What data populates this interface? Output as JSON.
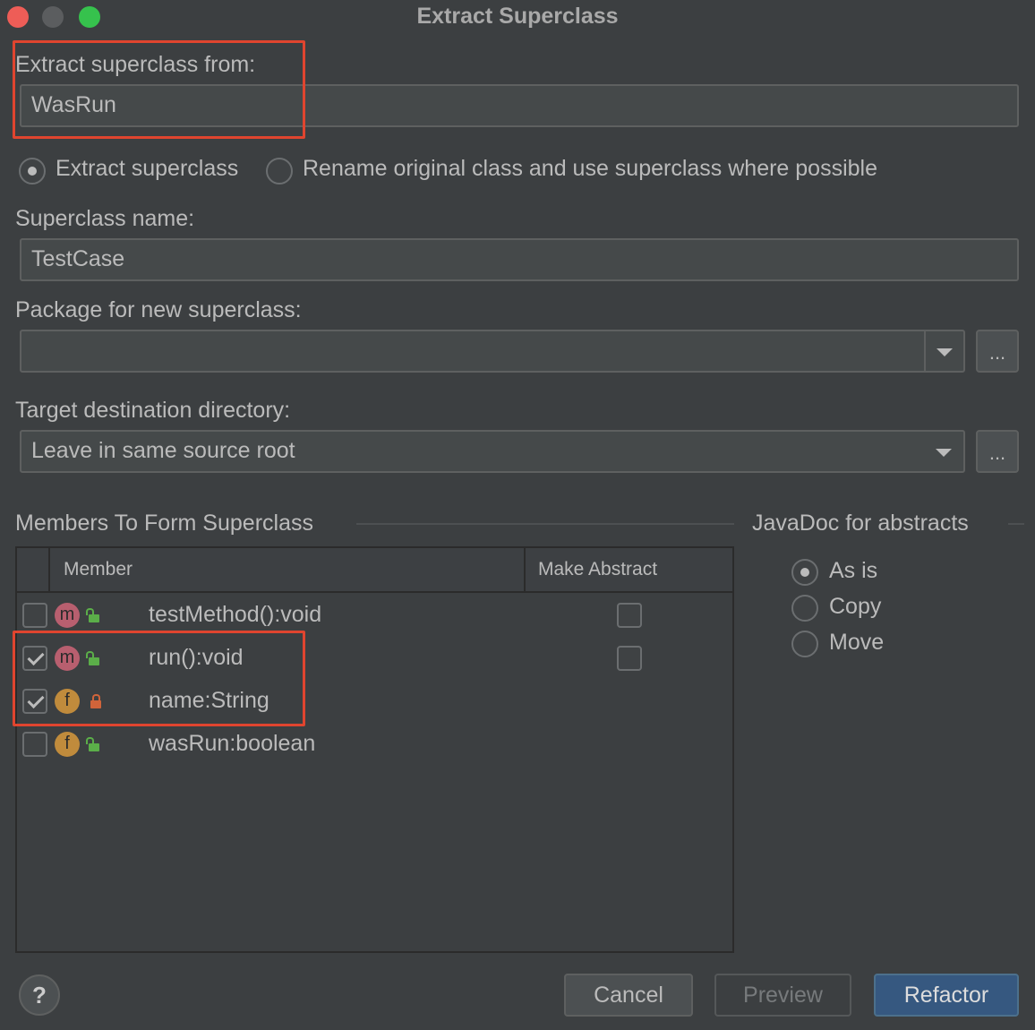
{
  "window": {
    "title": "Extract Superclass"
  },
  "extract_from": {
    "label": "Extract superclass from:",
    "value": "WasRun"
  },
  "mode": {
    "options": [
      {
        "label": "Extract superclass",
        "selected": true
      },
      {
        "label": "Rename original class and use superclass where possible",
        "selected": false
      }
    ]
  },
  "superclass_name": {
    "label": "Superclass name:",
    "value": "TestCase"
  },
  "package": {
    "label": "Package for new superclass:",
    "value": "",
    "browse_label": "..."
  },
  "target_dir": {
    "label": "Target destination directory:",
    "value": "Leave in same source root",
    "browse_label": "..."
  },
  "members": {
    "title": "Members To Form Superclass",
    "columns": [
      "Member",
      "Make Abstract"
    ],
    "rows": [
      {
        "checked": false,
        "kind": "m",
        "access": "public",
        "name": "testMethod():void",
        "make_abstract": false,
        "has_abstract_box": true
      },
      {
        "checked": true,
        "kind": "m",
        "access": "public",
        "name": "run():void",
        "make_abstract": false,
        "has_abstract_box": true
      },
      {
        "checked": true,
        "kind": "f",
        "access": "private",
        "name": "name:String",
        "has_abstract_box": false
      },
      {
        "checked": false,
        "kind": "f",
        "access": "public",
        "name": "wasRun:boolean",
        "has_abstract_box": false
      }
    ]
  },
  "javadoc": {
    "title": "JavaDoc for abstracts",
    "options": [
      {
        "label": "As is",
        "selected": true
      },
      {
        "label": "Copy",
        "selected": false
      },
      {
        "label": "Move",
        "selected": false
      }
    ]
  },
  "buttons": {
    "help": "?",
    "cancel": "Cancel",
    "preview": "Preview",
    "refactor": "Refactor"
  },
  "colors": {
    "background": "#3c3f41",
    "highlight": "#e0452f",
    "primary_button": "#365880"
  }
}
